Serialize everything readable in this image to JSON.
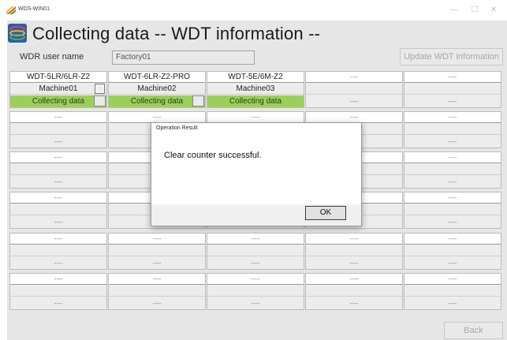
{
  "window": {
    "title": "WDS-WIN01",
    "minimize": "—",
    "maximize": "☐",
    "close": "✕"
  },
  "page": {
    "title": "Collecting data -- WDT information --"
  },
  "user": {
    "label": "WDR user name",
    "value": "Factory01"
  },
  "buttons": {
    "update_label": "Update WDT information",
    "back_label": "Back"
  },
  "grid": {
    "placeholder": "----",
    "cells": [
      {
        "row": 0,
        "col": 0,
        "header": "WDT-5LR/6LR-Z2",
        "machine": "Machine01",
        "status": "Collecting data",
        "active": true
      },
      {
        "row": 0,
        "col": 1,
        "header": "WDT-6LR-Z2-PRO",
        "machine": "Machine02",
        "status": "Collecting data",
        "active": true
      },
      {
        "row": 0,
        "col": 2,
        "header": "WDT-5E/6M-Z2",
        "machine": "Machine03",
        "status": "Collecting data",
        "active": true
      },
      {
        "row": 0,
        "col": 3,
        "header": "----",
        "machine": "",
        "status": "----",
        "active": false
      },
      {
        "row": 0,
        "col": 4,
        "header": "----",
        "machine": "",
        "status": "----",
        "active": false
      }
    ]
  },
  "dialog": {
    "title": "Operation Result",
    "message": "Clear counter successful.",
    "ok_label": "OK"
  },
  "colors": {
    "status_active": "#9ccf58",
    "background": "#e6e6e6"
  }
}
